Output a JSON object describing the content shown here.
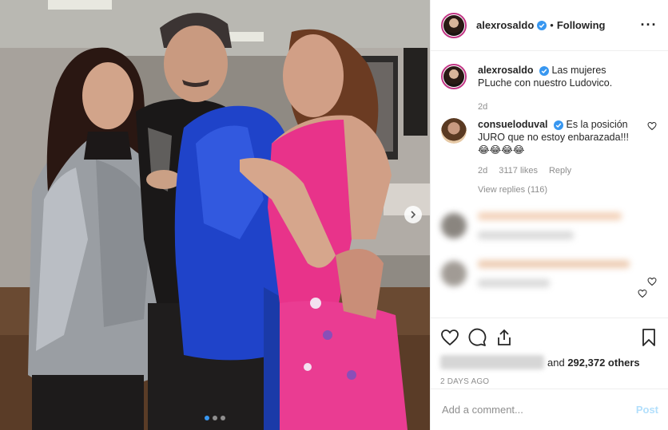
{
  "post": {
    "author": "alexrosaldo",
    "follow_status": "Following",
    "separator": "•",
    "more_label": "···"
  },
  "caption": {
    "username": "alexrosaldo",
    "text": "Las mujeres PLuche con nuestro Ludovico.",
    "age": "2d"
  },
  "comment": {
    "username": "consueloduval",
    "text": "Es la posición JURO que no estoy enbarazada!!! 😂😂😂😂",
    "age": "2d",
    "likes": "3117 likes",
    "reply_label": "Reply",
    "view_replies": "View replies (116)"
  },
  "likes": {
    "others": "and 292,372 others",
    "and_label": "and",
    "count": "292,372 others"
  },
  "timestamp": "2 DAYS AGO",
  "composer": {
    "placeholder": "Add a comment...",
    "post_label": "Post"
  },
  "carousel": {
    "pages": 3,
    "active": 1
  },
  "icons": {
    "verified": "verified-badge-icon",
    "more": "more-options-icon",
    "like": "heart-icon",
    "comment": "comment-bubble-icon",
    "share": "share-icon",
    "save": "bookmark-icon",
    "next": "chevron-right-icon"
  },
  "colors": {
    "verified": "#3897f0",
    "post_disabled": "#b2dffc",
    "muted": "#8e8e8e",
    "text": "#262626",
    "story_ring": "#c13584"
  }
}
